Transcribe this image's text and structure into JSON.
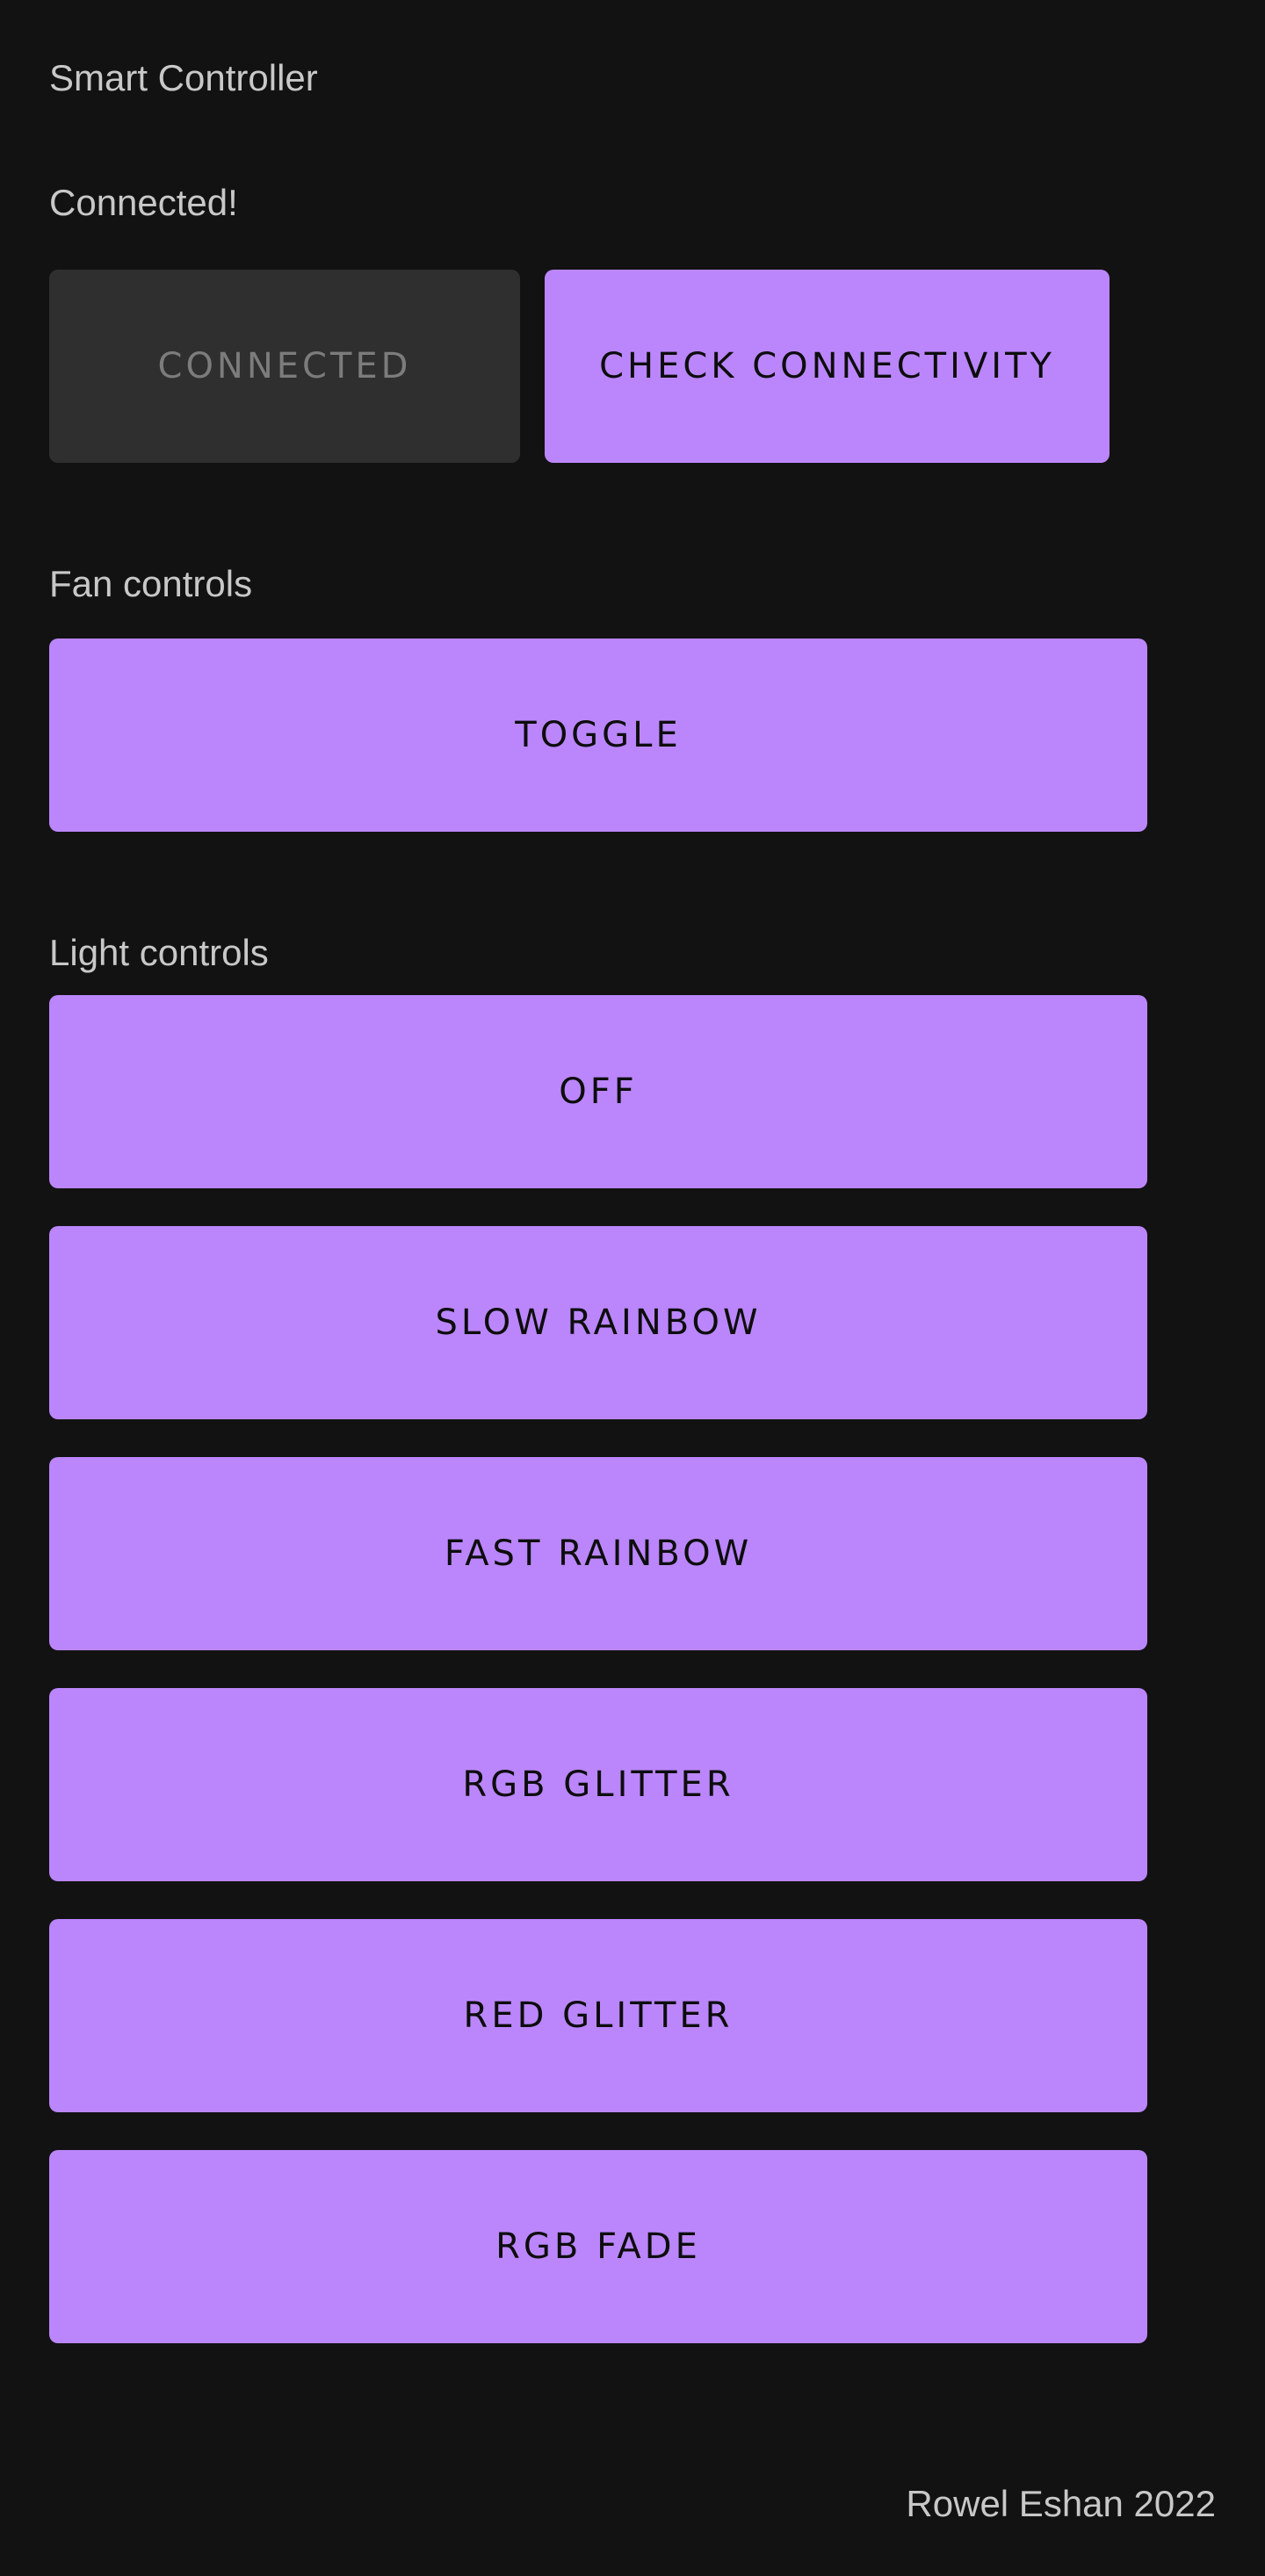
{
  "app": {
    "title": "Smart Controller",
    "status": "Connected!"
  },
  "connection": {
    "connect_label": "CONNECTED",
    "check_label": "CHECK CONNECTIVITY"
  },
  "fan": {
    "heading": "Fan controls",
    "toggle_label": "TOGGLE"
  },
  "light": {
    "heading": "Light controls",
    "buttons": [
      {
        "label": "OFF"
      },
      {
        "label": "SLOW RAINBOW"
      },
      {
        "label": "FAST RAINBOW"
      },
      {
        "label": "RGB GLITTER"
      },
      {
        "label": "RED GLITTER"
      },
      {
        "label": "RGB FADE"
      }
    ]
  },
  "footer": {
    "credit": "Rowel Eshan 2022"
  },
  "colors": {
    "background": "#121212",
    "accent": "#bb86fc",
    "disabled": "#2f2f2f"
  }
}
